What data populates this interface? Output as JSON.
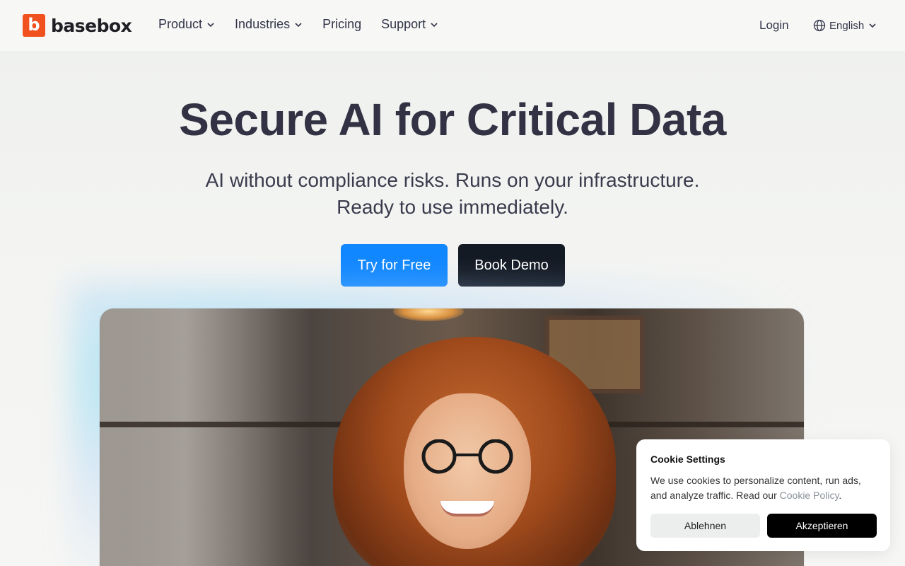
{
  "brand": {
    "logo_letter": "b",
    "name": "basebox",
    "accent": "#f0511e"
  },
  "nav": {
    "items": [
      {
        "label": "Product",
        "has_dropdown": true
      },
      {
        "label": "Industries",
        "has_dropdown": true
      },
      {
        "label": "Pricing",
        "has_dropdown": false
      },
      {
        "label": "Support",
        "has_dropdown": true
      }
    ],
    "login": "Login",
    "language": "English"
  },
  "hero": {
    "title": "Secure AI for Critical Data",
    "subtitle_line1": "AI without compliance risks. Runs on your infrastructure.",
    "subtitle_line2": "Ready to use immediately.",
    "primary_cta": "Try for Free",
    "secondary_cta": "Book Demo",
    "primary_color": "#1187ff",
    "secondary_color": "#141a24"
  },
  "cookie": {
    "title": "Cookie Settings",
    "text_before": "We use cookies to personalize content, run ads, and analyze traffic. Read our ",
    "link": "Cookie Policy",
    "text_after": ".",
    "decline": "Ablehnen",
    "accept": "Akzeptieren"
  }
}
